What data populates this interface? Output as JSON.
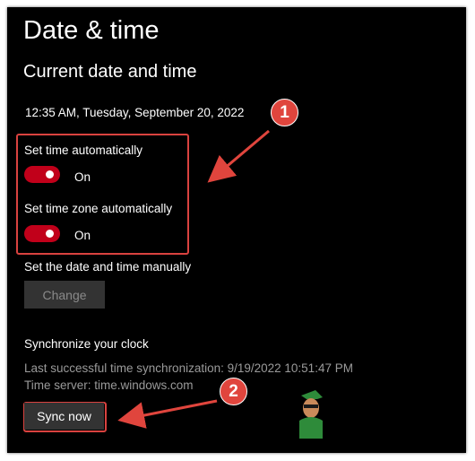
{
  "page": {
    "title": "Date & time",
    "section_current": "Current date and time",
    "current_datetime": "12:35 AM, Tuesday, September 20, 2022"
  },
  "auto_time": {
    "label": "Set time automatically",
    "state": "On"
  },
  "auto_timezone": {
    "label": "Set time zone automatically",
    "state": "On"
  },
  "manual": {
    "label": "Set the date and time manually",
    "button": "Change"
  },
  "sync": {
    "heading": "Synchronize your clock",
    "last_sync": "Last successful time synchronization: 9/19/2022 10:51:47 PM",
    "server": "Time server: time.windows.com",
    "button": "Sync now"
  },
  "annotations": {
    "badge_1": "1",
    "badge_2": "2"
  },
  "colors": {
    "accent": "#c1001a",
    "highlight": "#d9423f",
    "background": "#000000",
    "badge": "#e0453d"
  }
}
